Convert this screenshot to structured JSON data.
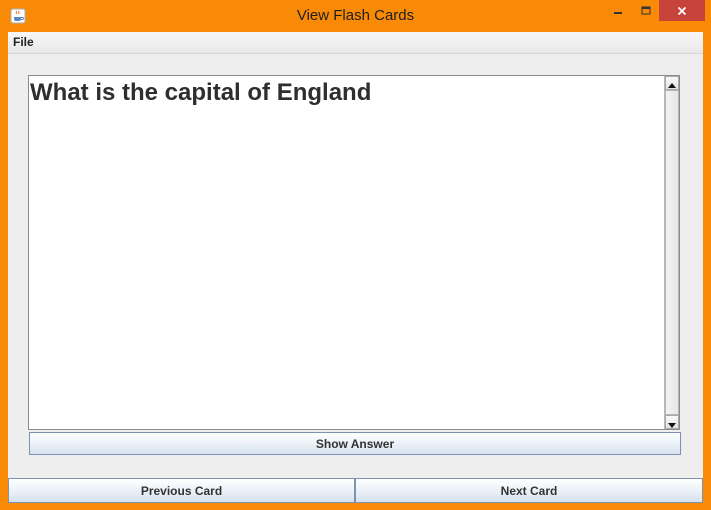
{
  "window": {
    "title": "View Flash Cards",
    "app_icon": "java-coffee-icon",
    "accent_color": "#f98a05",
    "controls": {
      "minimize_icon": "minimize-icon",
      "maximize_icon": "maximize-icon",
      "close_icon": "close-icon"
    }
  },
  "menubar": {
    "items": [
      {
        "label": "File"
      }
    ]
  },
  "card": {
    "question": "What is the capital of England"
  },
  "buttons": {
    "show_answer": "Show Answer",
    "previous_card": "Previous Card",
    "next_card": "Next Card"
  }
}
